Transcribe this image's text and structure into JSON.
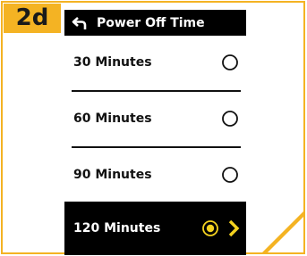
{
  "step_badge": "2d",
  "header": {
    "title": "Power Off Time",
    "back_icon": "back-arrow-icon"
  },
  "menu": {
    "items": [
      {
        "label": "30 Minutes",
        "selected": false
      },
      {
        "label": "60 Minutes",
        "selected": false
      },
      {
        "label": "90 Minutes",
        "selected": false
      },
      {
        "label": "120 Minutes",
        "selected": true
      }
    ]
  },
  "colors": {
    "accent": "#f4b323",
    "screen_bg": "#000000",
    "text": "#111111",
    "selected_text": "#ffffff"
  },
  "icons": {
    "radio_unselected": "radio-empty-icon",
    "radio_selected": "radio-selected-icon",
    "chevron": "chevron-right-icon"
  }
}
